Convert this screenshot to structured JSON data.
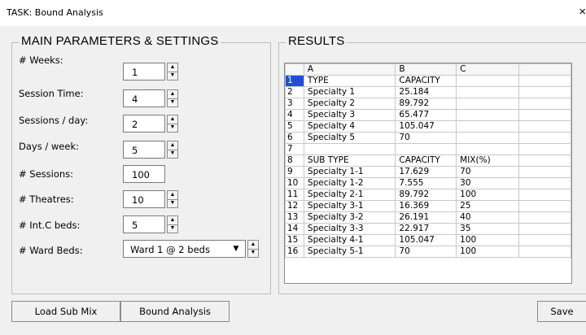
{
  "window": {
    "title": "TASK: Bound Analysis",
    "close": "×"
  },
  "params": {
    "legend": "MAIN PARAMETERS & SETTINGS",
    "rows": [
      {
        "label": "# Weeks:",
        "value": "1"
      },
      {
        "label": "Session Time:",
        "value": "4"
      },
      {
        "label": "Sessions / day:",
        "value": "2"
      },
      {
        "label": "Days / week:",
        "value": "5"
      },
      {
        "label": "# Sessions:",
        "value": "100"
      },
      {
        "label": "# Theatres:",
        "value": "10"
      },
      {
        "label": "# Int.C beds:",
        "value": "5"
      },
      {
        "label": "# Ward Beds:",
        "value": "Ward 1 @ 2 beds"
      }
    ]
  },
  "results": {
    "legend": "RESULTS",
    "columns": [
      "A",
      "B",
      "C"
    ],
    "rows": [
      [
        "1",
        "TYPE",
        "CAPACITY",
        ""
      ],
      [
        "2",
        "Specialty 1",
        "25.184",
        ""
      ],
      [
        "3",
        "Specialty 2",
        "89.792",
        ""
      ],
      [
        "4",
        "Specialty 3",
        "65.477",
        ""
      ],
      [
        "5",
        "Specialty 4",
        "105.047",
        ""
      ],
      [
        "6",
        "Specialty 5",
        "70",
        ""
      ],
      [
        "7",
        "",
        "",
        ""
      ],
      [
        "8",
        "SUB TYPE",
        "CAPACITY",
        "MIX(%)"
      ],
      [
        "9",
        "Specialty 1-1",
        "17.629",
        "70"
      ],
      [
        "10",
        "Specialty 1-2",
        "7.555",
        "30"
      ],
      [
        "11",
        "Specialty 2-1",
        "89.792",
        "100"
      ],
      [
        "12",
        "Specialty 3-1",
        "16.369",
        "25"
      ],
      [
        "13",
        "Specialty 3-2",
        "26.191",
        "40"
      ],
      [
        "14",
        "Specialty 3-3",
        "22.917",
        "35"
      ],
      [
        "15",
        "Specialty 4-1",
        "105.047",
        "100"
      ],
      [
        "16",
        "Specialty 5-1",
        "70",
        "100"
      ]
    ]
  },
  "buttons": {
    "load": "Load Sub Mix",
    "bound": "Bound Analysis",
    "save": "Save"
  },
  "icons": {
    "spin_up": "▲",
    "spin_down": "▼",
    "dropdown": "▼"
  },
  "colors": {
    "selected_row_header": "#1b4fd8"
  }
}
